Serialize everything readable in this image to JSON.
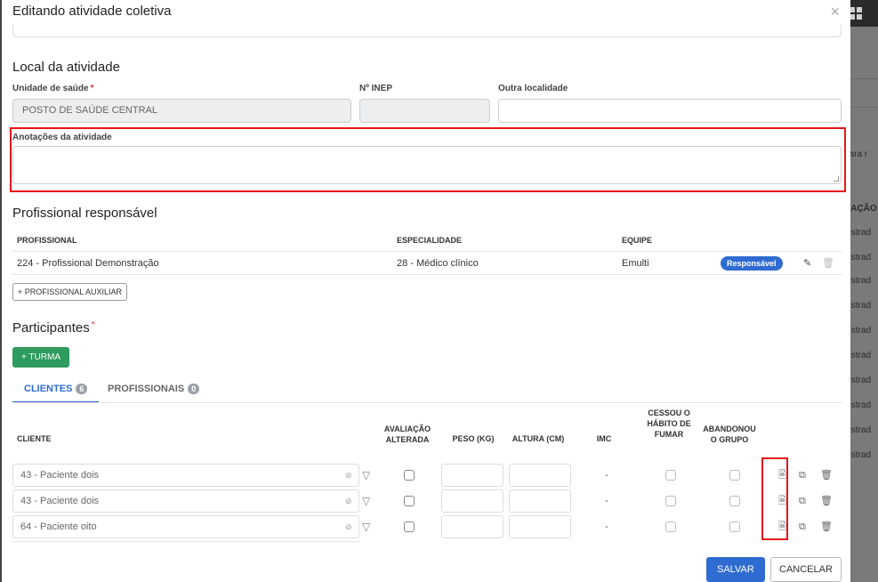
{
  "modal": {
    "title": "Editando atividade coletiva",
    "close": "×"
  },
  "local": {
    "title": "Local da atividade",
    "unidade_label": "Unidade de saúde",
    "unidade_value": "POSTO DE SAÚDE CENTRAL",
    "inep_label": "Nº INEP",
    "inep_value": "",
    "outra_label": "Outra localidade",
    "outra_value": "",
    "anotacoes_label": "Anotações da atividade",
    "anotacoes_value": ""
  },
  "profissional": {
    "title": "Profissional responsável",
    "headers": [
      "PROFISSIONAL",
      "ESPECIALIDADE",
      "EQUIPE"
    ],
    "row": {
      "profissional": "224 - Profissional Demonstração",
      "especialidade": "28 - Médico clínico",
      "equipe": "Emulti",
      "badge": "Responsável"
    },
    "aux_button": "+ PROFISSIONAL AUXILIAR"
  },
  "participantes": {
    "title": "Participantes",
    "turma_button": "+ TURMA",
    "tabs": [
      {
        "label": "CLIENTES",
        "count": "6"
      },
      {
        "label": "PROFISSIONAIS",
        "count": "0"
      }
    ],
    "headers": {
      "cliente": "CLIENTE",
      "avaliacao": "AVALIAÇÃO ALTERADA",
      "peso": "PESO (KG)",
      "altura": "ALTURA (CM)",
      "imc": "IMC",
      "cessou": "CESSOU O HÁBITO DE FUMAR",
      "abandonou": "ABANDONOU O GRUPO"
    },
    "rows": [
      {
        "cliente": "43 - Paciente dois",
        "imc": "-"
      },
      {
        "cliente": "43 - Paciente dois",
        "imc": "-"
      },
      {
        "cliente": "64 - Paciente oito",
        "imc": "-"
      }
    ]
  },
  "footer": {
    "save": "SALVAR",
    "cancel": "CANCELAR"
  },
  "background": {
    "snippets": [
      "para r",
      "UAÇÃO",
      "gistrad",
      "gistrad",
      "gistrad",
      "gistrad",
      "gistrad",
      "gistrad",
      "gistrad",
      "gistrad",
      "gistrad",
      "gistrad",
      "gistrad"
    ]
  }
}
